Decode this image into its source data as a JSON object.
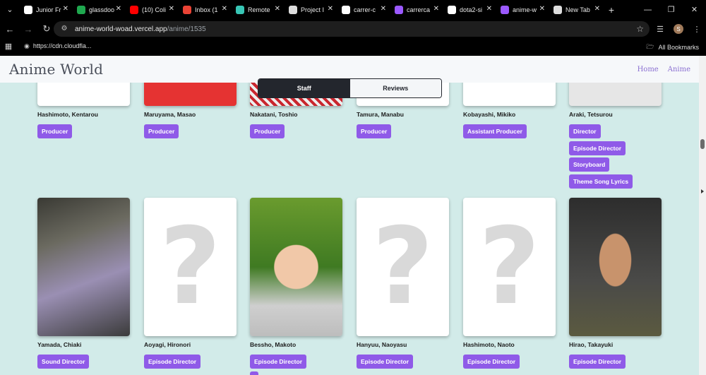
{
  "browser": {
    "tabs": [
      {
        "title": "Junior Fr",
        "icon": "globe-icon",
        "color": "#ffffff"
      },
      {
        "title": "glassdoo",
        "icon": "glassdoor-icon",
        "color": "#1fa84f"
      },
      {
        "title": "(10) Coli",
        "icon": "youtube-icon",
        "color": "#ff0000"
      },
      {
        "title": "Inbox (1",
        "icon": "gmail-icon",
        "color": "#ea4335"
      },
      {
        "title": "Remote",
        "icon": "remote-icon",
        "color": "#38c6b5"
      },
      {
        "title": "Project I",
        "icon": "project-icon",
        "color": "#dddddd"
      },
      {
        "title": "carrer-c",
        "icon": "vercel-icon",
        "color": "#ffffff"
      },
      {
        "title": "carrerca",
        "icon": "vite-icon",
        "color": "#9b59ff"
      },
      {
        "title": "dota2-si",
        "icon": "vercel-icon",
        "color": "#ffffff"
      },
      {
        "title": "anime-w",
        "icon": "vite-icon",
        "color": "#9b59ff"
      },
      {
        "title": "New Tab",
        "icon": "chrome-icon",
        "color": "#dddddd"
      }
    ],
    "url_host": "anime-world-woad.vercel.app",
    "url_path": "/anime/1535",
    "profile_initial": "S",
    "bookmark": "https://cdn.cloudfla...",
    "all_bookmarks": "All Bookmarks"
  },
  "site": {
    "brand": "Anime World",
    "nav": [
      "Home",
      "Anime"
    ]
  },
  "toggle": {
    "staff": "Staff",
    "reviews": "Reviews"
  },
  "staff": [
    {
      "name": "Hashimoto, Kentarou",
      "roles": [
        "Producer"
      ],
      "photo": "placeholder"
    },
    {
      "name": "Maruyama, Masao",
      "roles": [
        "Producer"
      ],
      "photo": "red"
    },
    {
      "name": "Nakatani, Toshio",
      "roles": [
        "Producer"
      ],
      "photo": "checker"
    },
    {
      "name": "Tamura, Manabu",
      "roles": [
        "Producer"
      ],
      "photo": "placeholder"
    },
    {
      "name": "Kobayashi, Mikiko",
      "roles": [
        "Assistant Producer"
      ],
      "photo": "placeholder"
    },
    {
      "name": "Araki, Tetsurou",
      "roles": [
        "Director",
        "Episode Director",
        "Storyboard",
        "Theme Song Lyrics"
      ],
      "photo": "white"
    },
    {
      "name": "Yamada, Chiaki",
      "roles": [
        "Sound Director"
      ],
      "photo": "dark"
    },
    {
      "name": "Aoyagi, Hironori",
      "roles": [
        "Episode Director"
      ],
      "photo": "placeholder"
    },
    {
      "name": "Bessho, Makoto",
      "roles": [
        "Episode Director",
        ""
      ],
      "photo": "green"
    },
    {
      "name": "Hanyuu, Naoyasu",
      "roles": [
        "Episode Director"
      ],
      "photo": "placeholder"
    },
    {
      "name": "Hashimoto, Naoto",
      "roles": [
        "Episode Director"
      ],
      "photo": "placeholder"
    },
    {
      "name": "Hirao, Takayuki",
      "roles": [
        "Episode Director"
      ],
      "photo": "grey"
    }
  ],
  "placeholder_glyph": "?"
}
